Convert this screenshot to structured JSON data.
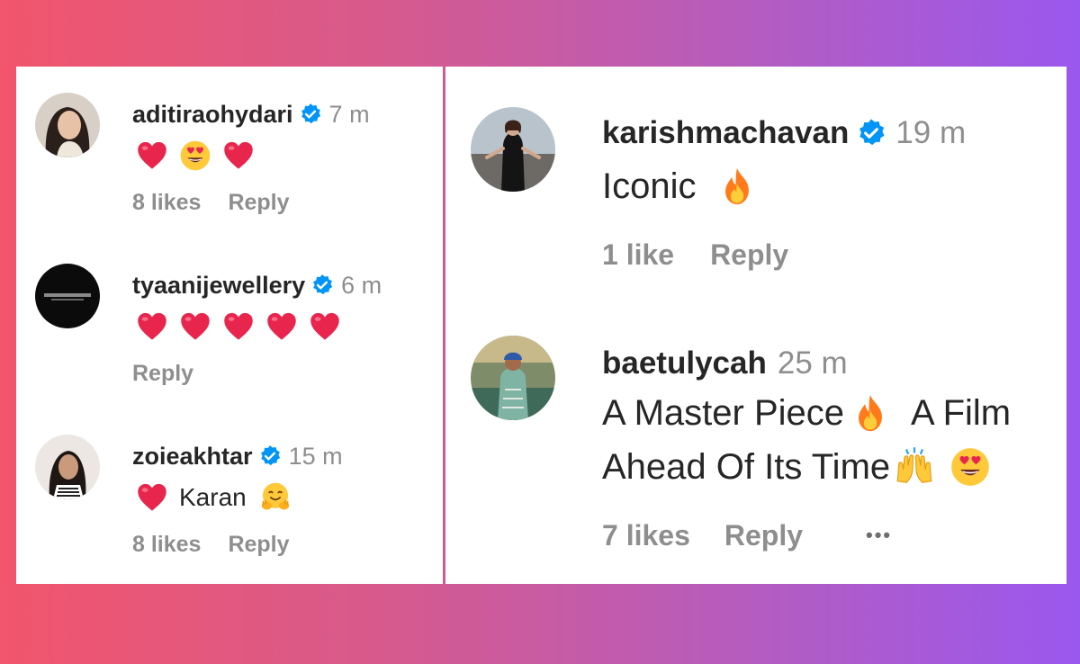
{
  "left_comments": [
    {
      "username": "aditiraohydari",
      "time": "7 m",
      "text": "",
      "emojis": [
        "red-heart-icon",
        "heart-eyes-face-icon",
        "red-heart-icon"
      ],
      "likes": "8 likes",
      "reply": "Reply"
    },
    {
      "username": "tyaanijewellery",
      "time": "6 m",
      "text": "",
      "emojis": [
        "red-heart-icon",
        "red-heart-icon",
        "red-heart-icon",
        "red-heart-icon",
        "red-heart-icon"
      ],
      "likes": "",
      "reply": "Reply"
    },
    {
      "username": "zoieakhtar",
      "time": "15 m",
      "text": "Karan",
      "emojis": [
        "red-heart-icon",
        "hugging-face-icon"
      ],
      "likes": "8 likes",
      "reply": "Reply"
    }
  ],
  "right_comments": [
    {
      "username": "karishmachavan",
      "time": "19 m",
      "text": "Iconic",
      "emojis": [
        "fire-icon"
      ],
      "likes": "1 like",
      "reply": "Reply"
    },
    {
      "username": "baetulycah",
      "time": "25 m",
      "text_line1_a": "A Master Piece",
      "text_line1_b": "A Film",
      "text_line2": "Ahead Of Its Time",
      "emojis": [
        "fire-icon",
        "raising-hands-icon",
        "heart-eyes-face-icon"
      ],
      "likes": "7 likes",
      "reply": "Reply",
      "more": "•••"
    }
  ],
  "colors": {
    "verified": "#0095f6",
    "muted_text": "#8e8e8e",
    "heart": "#e8264d"
  }
}
